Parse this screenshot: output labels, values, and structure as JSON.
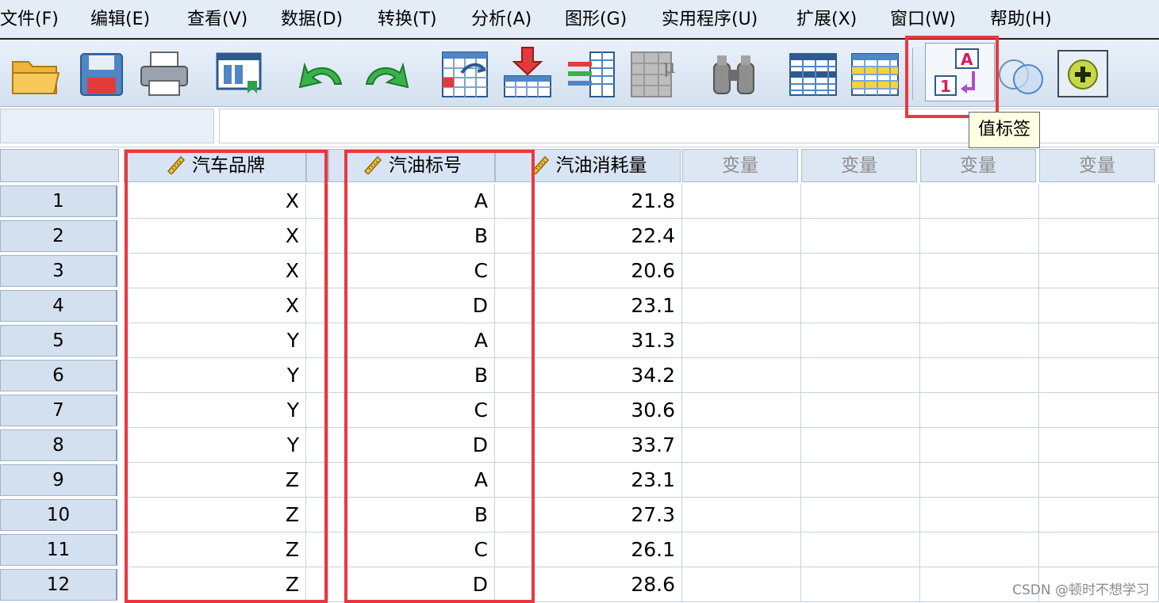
{
  "menu": [
    "文件(F)",
    "编辑(E)",
    "查看(V)",
    "数据(D)",
    "转换(T)",
    "分析(A)",
    "图形(G)",
    "实用程序(U)",
    "扩展(X)",
    "窗口(W)",
    "帮助(H)"
  ],
  "toolbar": {
    "icons": [
      "open-folder-icon",
      "save-icon",
      "print-icon",
      "recall-dialog-icon",
      "undo-icon",
      "redo-icon",
      "go-to-case-icon",
      "go-to-variable-icon",
      "variables-icon",
      "run-descriptives-icon",
      "find-icon",
      "split-file-icon",
      "select-cases-icon",
      "value-labels-icon",
      "use-sets-icon",
      "add-ons-icon"
    ],
    "tooltip": "值标签"
  },
  "columns": [
    {
      "name": "汽车品牌",
      "icon": "ruler-icon"
    },
    {
      "name": "汽油标号",
      "icon": "ruler-icon"
    },
    {
      "name": "汽油消耗量",
      "icon": "ruler-icon"
    },
    {
      "name": "变量"
    },
    {
      "name": "变量"
    },
    {
      "name": "变量"
    },
    {
      "name": "变量"
    }
  ],
  "rows": [
    {
      "n": "1",
      "brand": "X",
      "grade": "A",
      "consumption": "21.8"
    },
    {
      "n": "2",
      "brand": "X",
      "grade": "B",
      "consumption": "22.4"
    },
    {
      "n": "3",
      "brand": "X",
      "grade": "C",
      "consumption": "20.6"
    },
    {
      "n": "4",
      "brand": "X",
      "grade": "D",
      "consumption": "23.1"
    },
    {
      "n": "5",
      "brand": "Y",
      "grade": "A",
      "consumption": "31.3"
    },
    {
      "n": "6",
      "brand": "Y",
      "grade": "B",
      "consumption": "34.2"
    },
    {
      "n": "7",
      "brand": "Y",
      "grade": "C",
      "consumption": "30.6"
    },
    {
      "n": "8",
      "brand": "Y",
      "grade": "D",
      "consumption": "33.7"
    },
    {
      "n": "9",
      "brand": "Z",
      "grade": "A",
      "consumption": "23.1"
    },
    {
      "n": "10",
      "brand": "Z",
      "grade": "B",
      "consumption": "27.3"
    },
    {
      "n": "11",
      "brand": "Z",
      "grade": "C",
      "consumption": "26.1"
    },
    {
      "n": "12",
      "brand": "Z",
      "grade": "D",
      "consumption": "28.6"
    }
  ],
  "watermark": "CSDN @顿时不想学习",
  "colors": {
    "highlight": "#e8393e",
    "tooltip_bg": "#ffffe1",
    "header_bg": "#d8e4f3"
  }
}
